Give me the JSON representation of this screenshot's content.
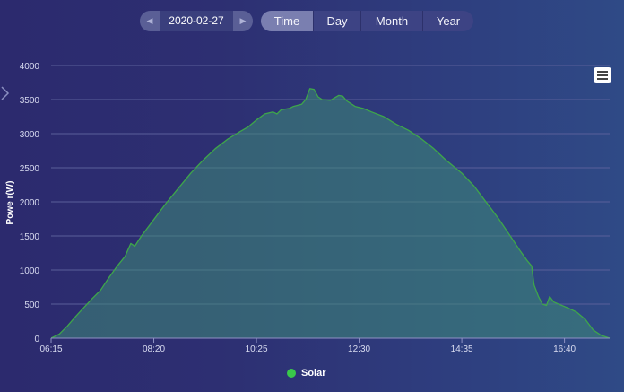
{
  "date_nav": {
    "date": "2020-02-27",
    "prev_icon": "skip-back-icon",
    "next_icon": "skip-forward-icon"
  },
  "tabs": [
    {
      "label": "Time",
      "active": true
    },
    {
      "label": "Day",
      "active": false
    },
    {
      "label": "Month",
      "active": false
    },
    {
      "label": "Year",
      "active": false
    }
  ],
  "menu_icon": "hamburger-menu-icon",
  "colors": {
    "series": "#3ea64a",
    "fill": "#3e8a78",
    "legend_dot": "#39c94a",
    "grid": "#5a5f9a"
  },
  "chart_data": {
    "type": "area",
    "ylabel": "Powe r(W)",
    "ylim": [
      0,
      4000
    ],
    "yticks": [
      "0",
      "500",
      "1000",
      "1500",
      "2000",
      "2500",
      "3000",
      "3500",
      "4000"
    ],
    "xlim": [
      "06:15",
      "17:35"
    ],
    "xticks": [
      "06:15",
      "08:20",
      "10:25",
      "12:30",
      "14:35",
      "16:40"
    ],
    "grid": true,
    "legend_position": "bottom-center",
    "series": [
      {
        "name": "Solar",
        "points": [
          [
            "06:15",
            0
          ],
          [
            "06:25",
            60
          ],
          [
            "06:35",
            180
          ],
          [
            "06:45",
            320
          ],
          [
            "06:55",
            450
          ],
          [
            "07:05",
            580
          ],
          [
            "07:15",
            700
          ],
          [
            "07:25",
            880
          ],
          [
            "07:35",
            1050
          ],
          [
            "07:45",
            1200
          ],
          [
            "07:52",
            1390
          ],
          [
            "07:57",
            1350
          ],
          [
            "08:05",
            1500
          ],
          [
            "08:20",
            1740
          ],
          [
            "08:35",
            1980
          ],
          [
            "08:50",
            2200
          ],
          [
            "09:05",
            2420
          ],
          [
            "09:20",
            2610
          ],
          [
            "09:35",
            2780
          ],
          [
            "09:50",
            2920
          ],
          [
            "10:05",
            3030
          ],
          [
            "10:15",
            3100
          ],
          [
            "10:25",
            3200
          ],
          [
            "10:35",
            3290
          ],
          [
            "10:45",
            3320
          ],
          [
            "10:50",
            3290
          ],
          [
            "10:55",
            3350
          ],
          [
            "11:05",
            3370
          ],
          [
            "11:10",
            3400
          ],
          [
            "11:20",
            3430
          ],
          [
            "11:25",
            3500
          ],
          [
            "11:30",
            3660
          ],
          [
            "11:35",
            3650
          ],
          [
            "11:40",
            3540
          ],
          [
            "11:45",
            3500
          ],
          [
            "11:55",
            3490
          ],
          [
            "12:05",
            3560
          ],
          [
            "12:10",
            3550
          ],
          [
            "12:15",
            3480
          ],
          [
            "12:25",
            3400
          ],
          [
            "12:35",
            3370
          ],
          [
            "12:45",
            3320
          ],
          [
            "13:00",
            3250
          ],
          [
            "13:15",
            3140
          ],
          [
            "13:30",
            3050
          ],
          [
            "13:45",
            2930
          ],
          [
            "14:00",
            2790
          ],
          [
            "14:15",
            2620
          ],
          [
            "14:35",
            2420
          ],
          [
            "14:50",
            2230
          ],
          [
            "15:05",
            1990
          ],
          [
            "15:20",
            1750
          ],
          [
            "15:35",
            1480
          ],
          [
            "15:45",
            1300
          ],
          [
            "15:55",
            1130
          ],
          [
            "16:00",
            1060
          ],
          [
            "16:03",
            780
          ],
          [
            "16:08",
            620
          ],
          [
            "16:13",
            500
          ],
          [
            "16:18",
            480
          ],
          [
            "16:22",
            610
          ],
          [
            "16:27",
            530
          ],
          [
            "16:35",
            490
          ],
          [
            "16:45",
            440
          ],
          [
            "16:55",
            380
          ],
          [
            "17:05",
            280
          ],
          [
            "17:15",
            120
          ],
          [
            "17:25",
            40
          ],
          [
            "17:35",
            0
          ]
        ]
      }
    ]
  }
}
